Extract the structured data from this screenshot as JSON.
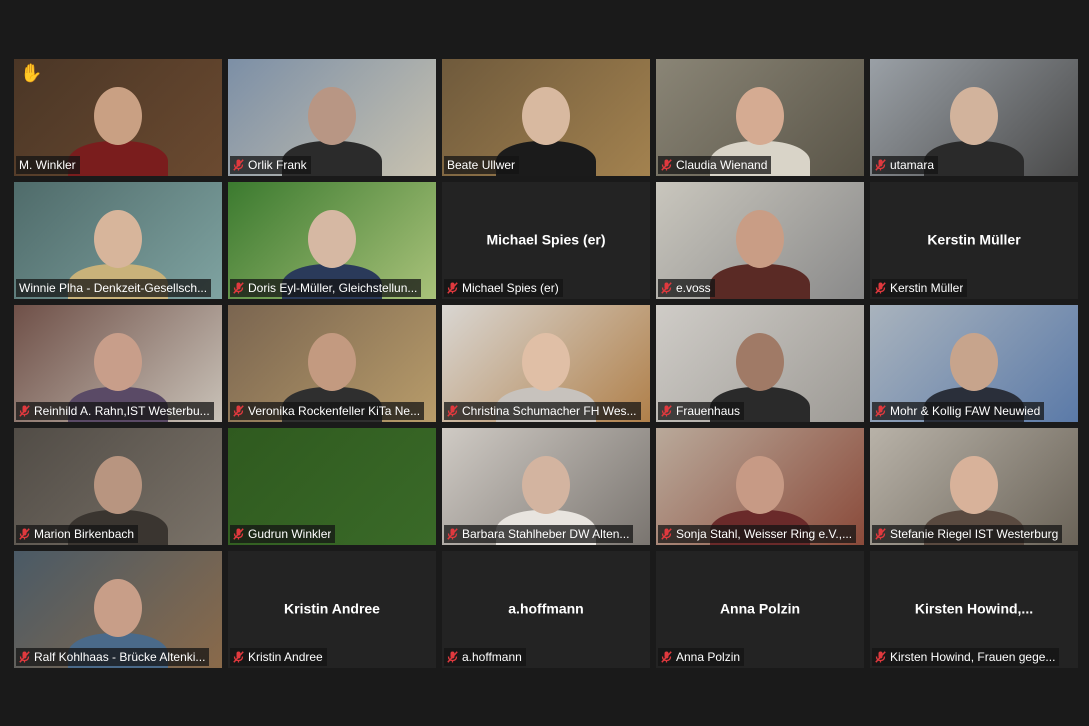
{
  "meeting": {
    "participants": [
      {
        "name": "M. Winkler",
        "video": true,
        "muted": false,
        "hand_raised": true,
        "scene": {
          "bg": "#4a3626",
          "accent": "#6b4a30",
          "skin": "#c9a083",
          "shirt": "#7a1d1d"
        }
      },
      {
        "name": "Orlik Frank",
        "video": true,
        "muted": true,
        "scene": {
          "bg": "#7c8fa6",
          "accent": "#c8c2b0",
          "skin": "#b89684",
          "shirt": "#2b2b2b"
        }
      },
      {
        "name": "Beate Ullwer",
        "video": true,
        "muted": false,
        "scene": {
          "bg": "#6f5a3c",
          "accent": "#a3824f",
          "skin": "#d8b9a0",
          "shirt": "#1b1b1b"
        }
      },
      {
        "name": "Claudia Wienand",
        "video": true,
        "muted": true,
        "scene": {
          "bg": "#8a8576",
          "accent": "#5a5548",
          "skin": "#d5ab92",
          "shirt": "#d9d4c8"
        }
      },
      {
        "name": "utamara",
        "video": true,
        "muted": true,
        "scene": {
          "bg": "#9aa0a6",
          "accent": "#4a4a4a",
          "skin": "#d2b39c",
          "shirt": "#2a2a2a"
        }
      },
      {
        "name": "Winnie Plha - Denkzeit-Gesellsch...",
        "video": true,
        "muted": false,
        "active": true,
        "scene": {
          "bg": "#4f6b6a",
          "accent": "#7fa3a1",
          "skin": "#d7b59b",
          "shirt": "#c9b27a"
        }
      },
      {
        "name": "Doris Eyl-Müller, Gleichstellun...",
        "video": true,
        "muted": true,
        "scene": {
          "bg": "#3b7a2f",
          "accent": "#a9c27a",
          "skin": "#d6b8a3",
          "shirt": "#2a3a5a"
        }
      },
      {
        "name": "Michael Spies (er)",
        "video": false,
        "muted": true,
        "center": "Michael Spies (er)"
      },
      {
        "name": "e.voss",
        "video": true,
        "muted": true,
        "scene": {
          "bg": "#c9c6bd",
          "accent": "#8a8a8a",
          "skin": "#c99d85",
          "shirt": "#5a2a25"
        }
      },
      {
        "name": "Kerstin Müller",
        "video": false,
        "muted": true,
        "center": "Kerstin Müller"
      },
      {
        "name": "Reinhild A. Rahn,IST Westerbu...",
        "video": true,
        "muted": true,
        "scene": {
          "bg": "#6f5048",
          "accent": "#c9c2b8",
          "skin": "#c89e8a",
          "shirt": "#5a4a66"
        }
      },
      {
        "name": "Veronika Rockenfeller KiTa Ne...",
        "video": true,
        "muted": true,
        "scene": {
          "bg": "#7a6550",
          "accent": "#b89c6a",
          "skin": "#c39a80",
          "shirt": "#2f2f2f"
        }
      },
      {
        "name": "Christina Schumacher FH Wes...",
        "video": true,
        "muted": true,
        "scene": {
          "bg": "#d9d6d2",
          "accent": "#b0804a",
          "skin": "#e0bfa6",
          "shirt": "#c7c2bd"
        }
      },
      {
        "name": "Frauenhaus",
        "video": true,
        "muted": true,
        "scene": {
          "bg": "#cfccc7",
          "accent": "#9d9a95",
          "skin": "#a07a66",
          "shirt": "#2a2a2a"
        }
      },
      {
        "name": "Mohr & Kollig FAW Neuwied",
        "video": true,
        "muted": true,
        "scene": {
          "bg": "#a9b3bd",
          "accent": "#5b7aa8",
          "skin": "#c7a48c",
          "shirt": "#2a2f3a"
        }
      },
      {
        "name": "Marion Birkenbach",
        "video": true,
        "muted": true,
        "scene": {
          "bg": "#514c46",
          "accent": "#7a7268",
          "skin": "#b89580",
          "shirt": "#3a3530"
        }
      },
      {
        "name": "Gudrun Winkler",
        "video": true,
        "muted": true,
        "scene": {
          "bg": "#2f5a1f",
          "accent": "#3a6a28",
          "skin": "#2f5a1f",
          "shirt": "#2f5a1f"
        }
      },
      {
        "name": "Barbara Stahlheber DW Alten...",
        "video": true,
        "muted": true,
        "scene": {
          "bg": "#cfcac4",
          "accent": "#7a7570",
          "skin": "#d3b4a0",
          "shirt": "#e8e4df"
        }
      },
      {
        "name": "Sonja Stahl, Weisser Ring e.V.,...",
        "video": true,
        "muted": true,
        "scene": {
          "bg": "#b9a99a",
          "accent": "#8a4a3a",
          "skin": "#c79a85",
          "shirt": "#6a2a2a"
        }
      },
      {
        "name": "Stefanie Riegel IST Westerburg",
        "video": true,
        "muted": true,
        "scene": {
          "bg": "#b8b2a8",
          "accent": "#6a6358",
          "skin": "#d8b29a",
          "shirt": "#5a4a40"
        }
      },
      {
        "name": "Ralf Kohlhaas - Brücke Altenki...",
        "video": true,
        "muted": true,
        "scene": {
          "bg": "#4a5a66",
          "accent": "#8a6a4a",
          "skin": "#c89e88",
          "shirt": "#4a6a8a"
        }
      },
      {
        "name": "Kristin Andree",
        "video": false,
        "muted": true,
        "center": "Kristin Andree"
      },
      {
        "name": "a.hoffmann",
        "video": false,
        "muted": true,
        "center": "a.hoffmann"
      },
      {
        "name": "Anna Polzin",
        "video": false,
        "muted": true,
        "center": "Anna Polzin"
      },
      {
        "name": "Kirsten Howind, Frauen gege...",
        "video": false,
        "muted": true,
        "center": "Kirsten  Howind,..."
      }
    ]
  },
  "icons": {
    "muted_mic": "muted-mic-icon",
    "raised_hand": "raised-hand-icon"
  },
  "colors": {
    "background": "#1a1a1a",
    "tile": "#232323",
    "active_border": "#c8e05a",
    "mute_red": "#e0393e"
  }
}
